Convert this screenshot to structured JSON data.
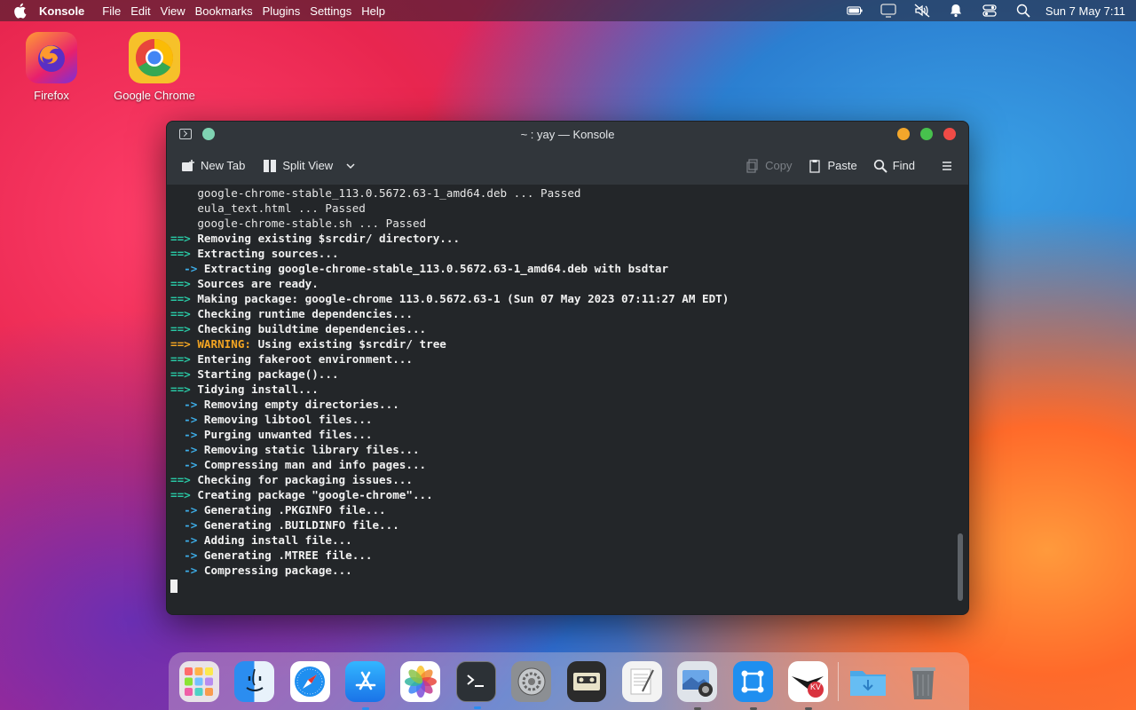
{
  "menubar": {
    "app_name": "Konsole",
    "menus": [
      "File",
      "Edit",
      "View",
      "Bookmarks",
      "Plugins",
      "Settings",
      "Help"
    ],
    "clock": "Sun 7 May 7:11"
  },
  "desktop": {
    "icons": [
      {
        "label": "Firefox"
      },
      {
        "label": "Google Chrome"
      }
    ]
  },
  "window": {
    "title": "~ : yay — Konsole",
    "toolbar": {
      "new_tab": "New Tab",
      "split_view": "Split View",
      "copy": "Copy",
      "paste": "Paste",
      "find": "Find"
    },
    "terminal": {
      "lines": [
        {
          "prefix": "",
          "prefix_type": "",
          "text": "    google-chrome-stable_113.0.5672.63-1_amd64.deb ... Passed",
          "text_type": "plain"
        },
        {
          "prefix": "",
          "prefix_type": "",
          "text": "    eula_text.html ... Passed",
          "text_type": "plain"
        },
        {
          "prefix": "",
          "prefix_type": "",
          "text": "    google-chrome-stable.sh ... Passed",
          "text_type": "plain"
        },
        {
          "prefix": "==>",
          "prefix_type": "g",
          "text": " Removing existing $srcdir/ directory...",
          "text_type": "bold"
        },
        {
          "prefix": "==>",
          "prefix_type": "g",
          "text": " Extracting sources...",
          "text_type": "bold"
        },
        {
          "prefix": "  ->",
          "prefix_type": "b",
          "text": " Extracting google-chrome-stable_113.0.5672.63-1_amd64.deb with bsdtar",
          "text_type": "bold"
        },
        {
          "prefix": "==>",
          "prefix_type": "g",
          "text": " Sources are ready.",
          "text_type": "bold"
        },
        {
          "prefix": "==>",
          "prefix_type": "g",
          "text": " Making package: google-chrome 113.0.5672.63-1 (Sun 07 May 2023 07:11:27 AM EDT)",
          "text_type": "bold"
        },
        {
          "prefix": "==>",
          "prefix_type": "g",
          "text": " Checking runtime dependencies...",
          "text_type": "bold"
        },
        {
          "prefix": "==>",
          "prefix_type": "g",
          "text": " Checking buildtime dependencies...",
          "text_type": "bold"
        },
        {
          "prefix": "==>",
          "prefix_type": "w",
          "text": " WARNING:",
          "text_type": "warn",
          "suffix": " Using existing $srcdir/ tree"
        },
        {
          "prefix": "==>",
          "prefix_type": "g",
          "text": " Entering fakeroot environment...",
          "text_type": "bold"
        },
        {
          "prefix": "==>",
          "prefix_type": "g",
          "text": " Starting package()...",
          "text_type": "bold"
        },
        {
          "prefix": "==>",
          "prefix_type": "g",
          "text": " Tidying install...",
          "text_type": "bold"
        },
        {
          "prefix": "  ->",
          "prefix_type": "b",
          "text": " Removing empty directories...",
          "text_type": "bold"
        },
        {
          "prefix": "  ->",
          "prefix_type": "b",
          "text": " Removing libtool files...",
          "text_type": "bold"
        },
        {
          "prefix": "  ->",
          "prefix_type": "b",
          "text": " Purging unwanted files...",
          "text_type": "bold"
        },
        {
          "prefix": "  ->",
          "prefix_type": "b",
          "text": " Removing static library files...",
          "text_type": "bold"
        },
        {
          "prefix": "  ->",
          "prefix_type": "b",
          "text": " Compressing man and info pages...",
          "text_type": "bold"
        },
        {
          "prefix": "==>",
          "prefix_type": "g",
          "text": " Checking for packaging issues...",
          "text_type": "bold"
        },
        {
          "prefix": "==>",
          "prefix_type": "g",
          "text": " Creating package \"google-chrome\"...",
          "text_type": "bold"
        },
        {
          "prefix": "  ->",
          "prefix_type": "b",
          "text": " Generating .PKGINFO file...",
          "text_type": "bold"
        },
        {
          "prefix": "  ->",
          "prefix_type": "b",
          "text": " Generating .BUILDINFO file...",
          "text_type": "bold"
        },
        {
          "prefix": "  ->",
          "prefix_type": "b",
          "text": " Adding install file...",
          "text_type": "bold"
        },
        {
          "prefix": "  ->",
          "prefix_type": "b",
          "text": " Generating .MTREE file...",
          "text_type": "bold"
        },
        {
          "prefix": "  ->",
          "prefix_type": "b",
          "text": " Compressing package...",
          "text_type": "bold"
        }
      ]
    }
  },
  "dock": {
    "items": [
      {
        "icon": "launchpad-icon",
        "running": false
      },
      {
        "icon": "finder-icon",
        "running": false
      },
      {
        "icon": "safari-icon",
        "running": false
      },
      {
        "icon": "app-store-icon",
        "running": true
      },
      {
        "icon": "photos-icon",
        "running": false
      },
      {
        "icon": "terminal-icon",
        "running": true
      },
      {
        "icon": "system-preferences-icon",
        "running": false
      },
      {
        "icon": "cassette-icon",
        "running": false
      },
      {
        "icon": "text-editor-icon",
        "running": false
      },
      {
        "icon": "screenshot-icon",
        "running": true
      },
      {
        "icon": "xcode-like-icon",
        "running": true
      },
      {
        "icon": "kvantum-icon",
        "running": true
      },
      {
        "icon": "downloads-folder-icon",
        "running": false
      },
      {
        "icon": "trash-icon",
        "running": false
      }
    ],
    "kvantum_badge": "KV"
  },
  "colors": {
    "accent_green": "#29c6a3",
    "accent_blue": "#3daee9",
    "warning": "#f4a522",
    "terminal_bg": "#232629"
  }
}
